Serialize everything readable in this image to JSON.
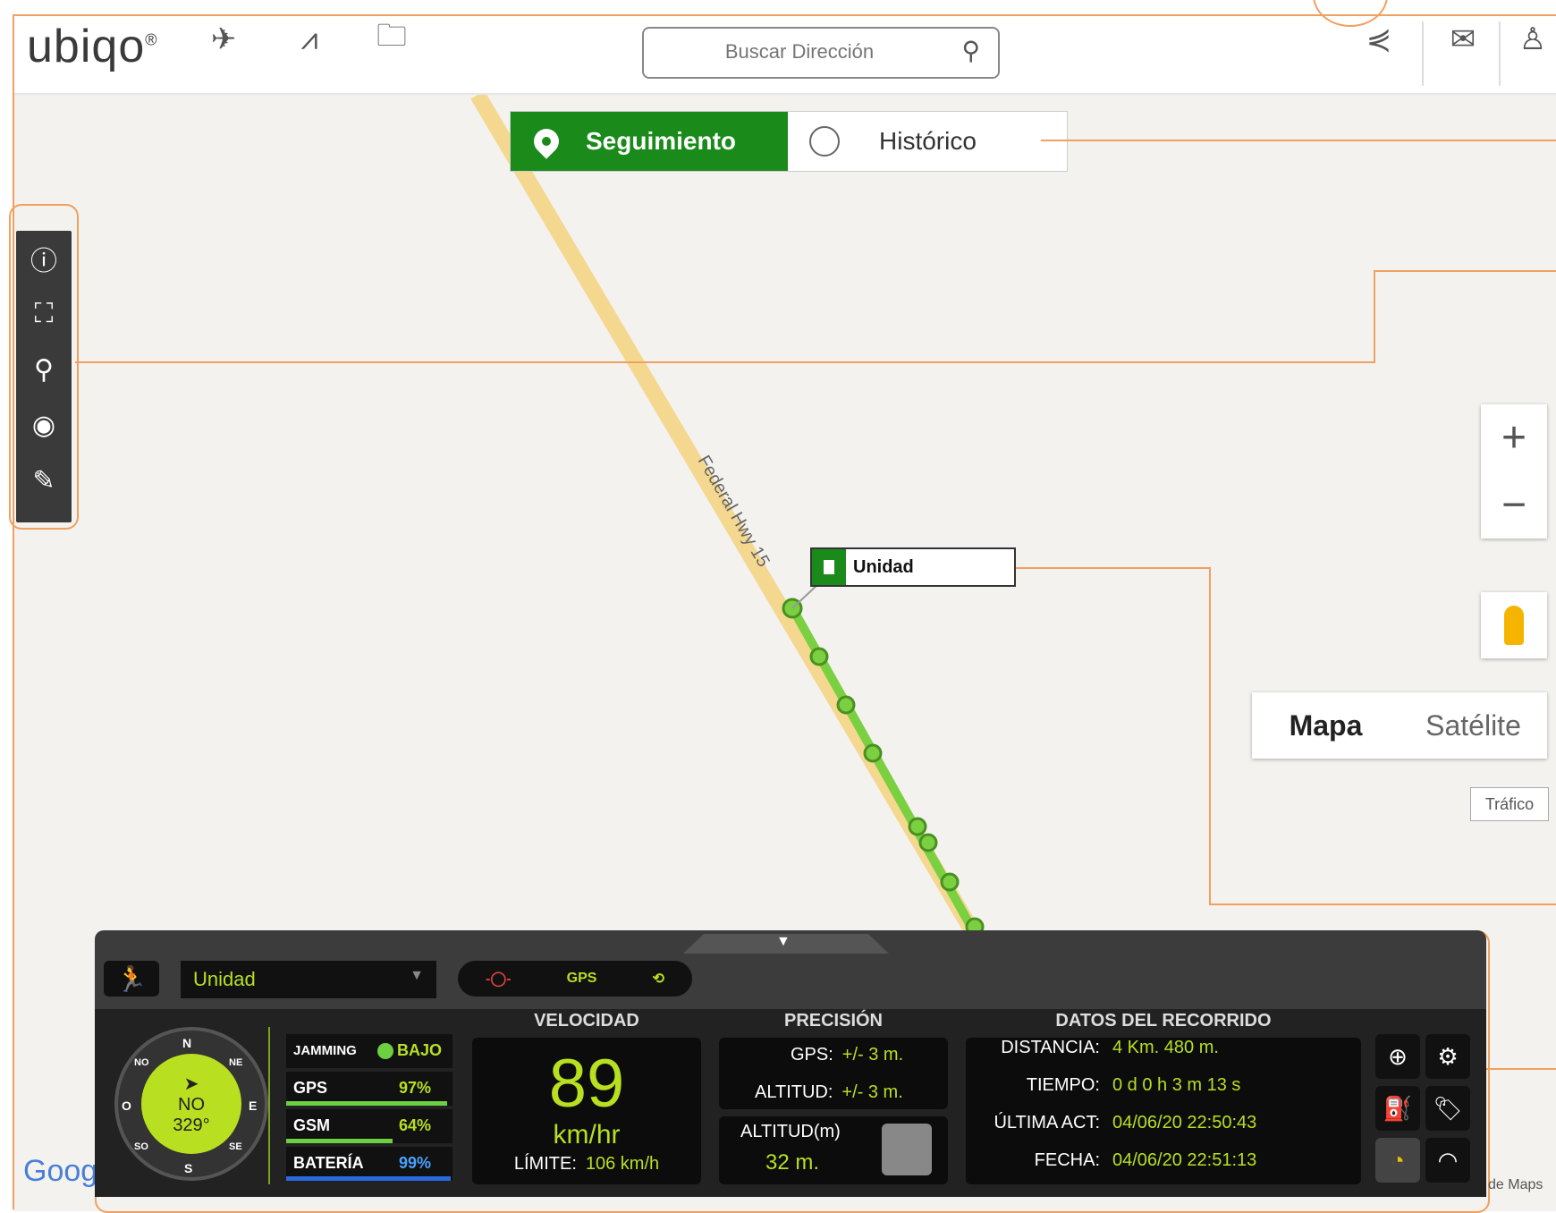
{
  "header": {
    "logo": "ubiqo",
    "logo_mark": "®",
    "search_placeholder": "Buscar Dirección"
  },
  "tabs": {
    "active": "Seguimiento",
    "inactive": "Histórico"
  },
  "map": {
    "zoom_in": "+",
    "zoom_out": "−",
    "map_types": [
      "Mapa",
      "Satélite"
    ],
    "traffic": "Tráfico",
    "unit_label": "Unidad",
    "google": "Goog",
    "attribution": "de Maps",
    "road_label": "Federal Hwy 15"
  },
  "panel": {
    "unit_select": "Unidad",
    "status": {
      "gps": "GPS"
    },
    "compass": {
      "heading": "NO",
      "degrees": "329°",
      "cardinals": [
        "N",
        "NE",
        "E",
        "SE",
        "S",
        "SO",
        "O",
        "NO"
      ]
    },
    "signals": {
      "jamming_label": "JAMMING",
      "jamming_value": "BAJO",
      "gps_label": "GPS",
      "gps_value": "97%",
      "gps_level": 0.97,
      "gsm_label": "GSM",
      "gsm_value": "64%",
      "gsm_level": 0.64,
      "battery_label": "BATERÍA",
      "battery_value": "99%",
      "battery_level": 0.99
    },
    "velocidad": {
      "header": "VELOCIDAD",
      "value": "89",
      "unit": "km/hr",
      "limit_label": "LÍMITE:",
      "limit_value": "106 km/h"
    },
    "precision": {
      "header": "PRECISIÓN",
      "gps_label": "GPS:",
      "gps_value": "+/- 3 m.",
      "alt_label": "ALTITUD:",
      "alt_value": "+/- 3 m.",
      "altitude_header": "ALTITUD(m)",
      "altitude_value": "32 m."
    },
    "recorrido": {
      "header": "DATOS DEL RECORRIDO",
      "distance_label": "DISTANCIA:",
      "distance_value": "4 Km. 480 m.",
      "time_label": "TIEMPO:",
      "time_value": "0 d 0 h 3 m 13 s",
      "last_label": "ÚLTIMA ACT:",
      "last_value": "04/06/20 22:50:43",
      "date_label": "FECHA:",
      "date_value": "04/06/20 22:51:13"
    }
  },
  "colors": {
    "accent_green": "#1a8a1a",
    "lime": "#b8e020",
    "annotation": "#f0a060"
  }
}
